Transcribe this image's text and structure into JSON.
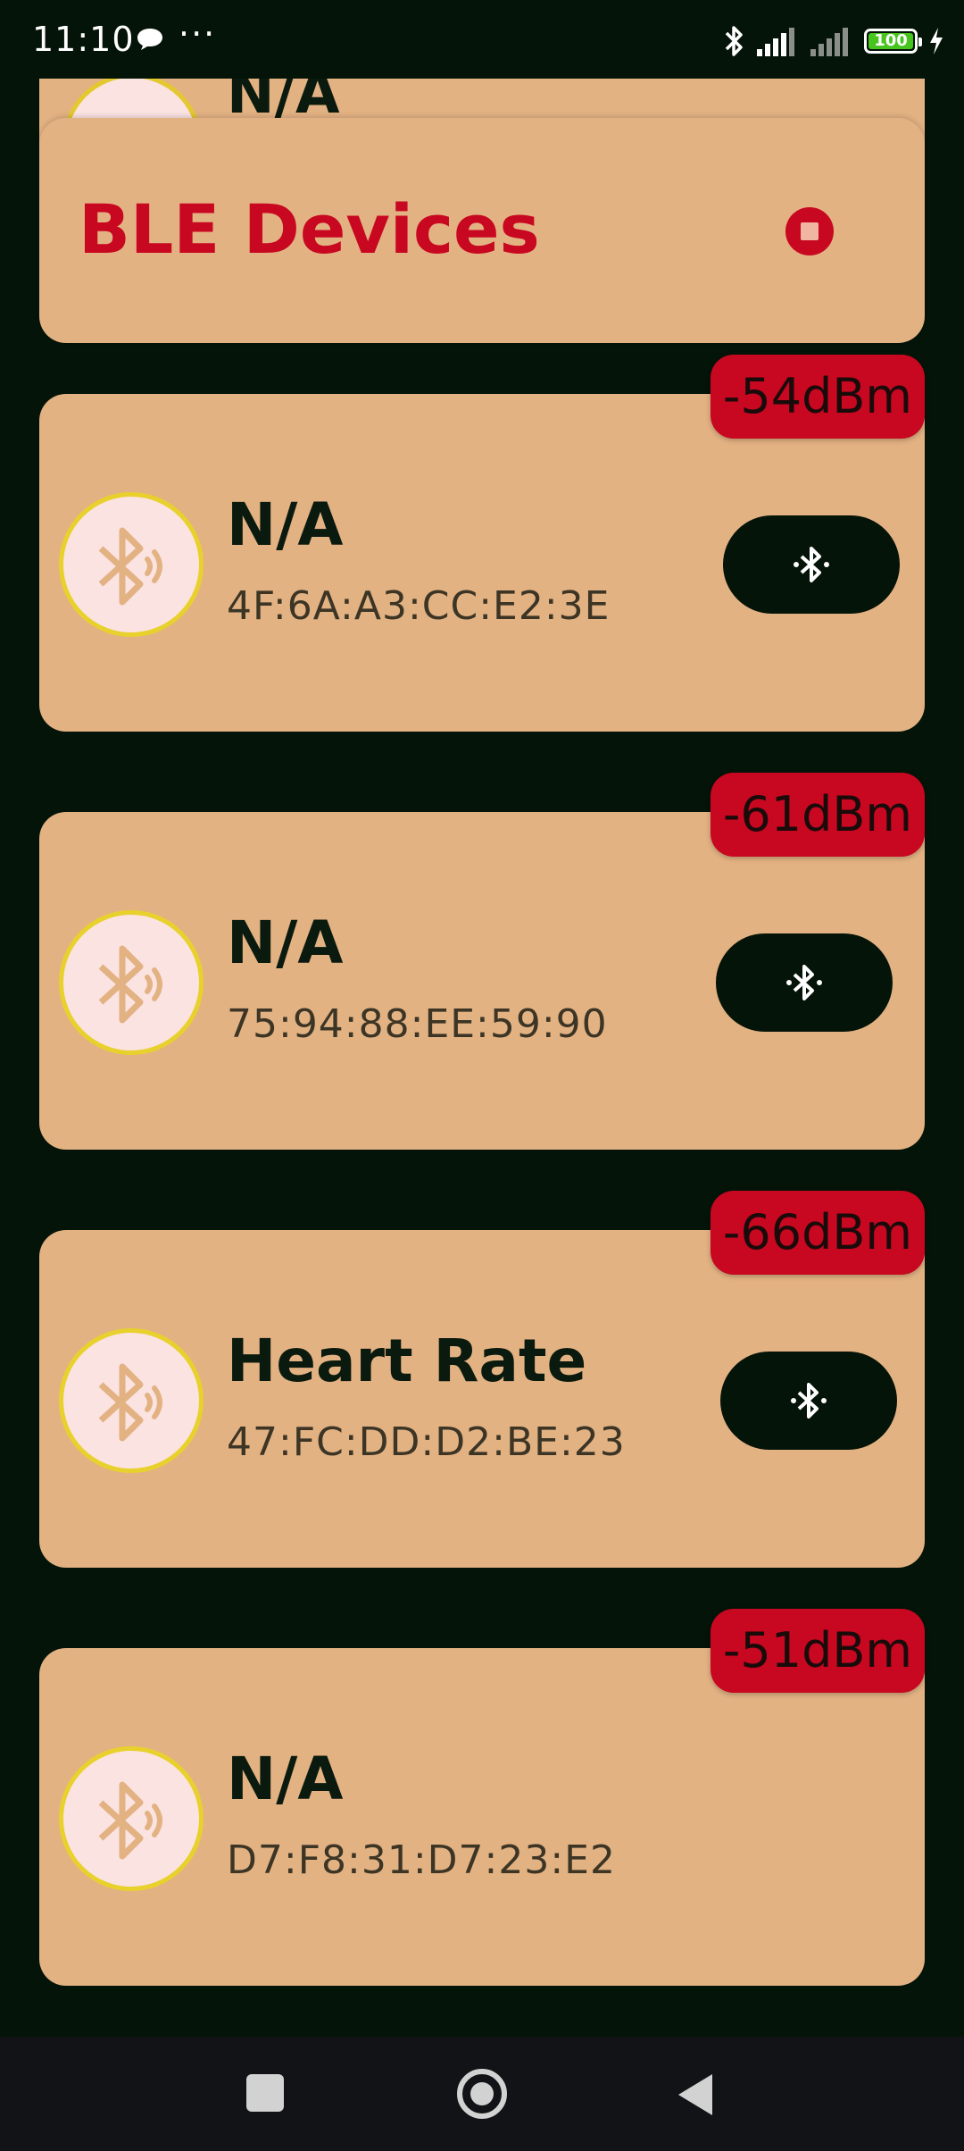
{
  "status_bar": {
    "time": "11:10",
    "overflow": "···",
    "battery": "100"
  },
  "header": {
    "title": "BLE Devices"
  },
  "peek_card": {
    "name": "N/A"
  },
  "devices": [
    {
      "name": "N/A",
      "address": "4F:6A:A3:CC:E2:3E",
      "rssi": "-54dBm",
      "connectable": true
    },
    {
      "name": "N/A",
      "address": "75:94:88:EE:59:90",
      "rssi": "-61dBm",
      "connectable": true
    },
    {
      "name": "Heart Rate",
      "address": "47:FC:DD:D2:BE:23",
      "rssi": "-66dBm",
      "connectable": true
    },
    {
      "name": "N/A",
      "address": "D7:F8:31:D7:23:E2",
      "rssi": "-51dBm",
      "connectable": false
    }
  ],
  "colors": {
    "background": "#051409",
    "card": "#e3b283",
    "accent": "#c80720",
    "avatar_bg": "#fbe3e2",
    "avatar_ring": "#e8d12c"
  },
  "icons": {
    "avatar": "bluetooth-audio-icon",
    "connect": "bluetooth-connect-icon",
    "stop": "stop-icon"
  }
}
